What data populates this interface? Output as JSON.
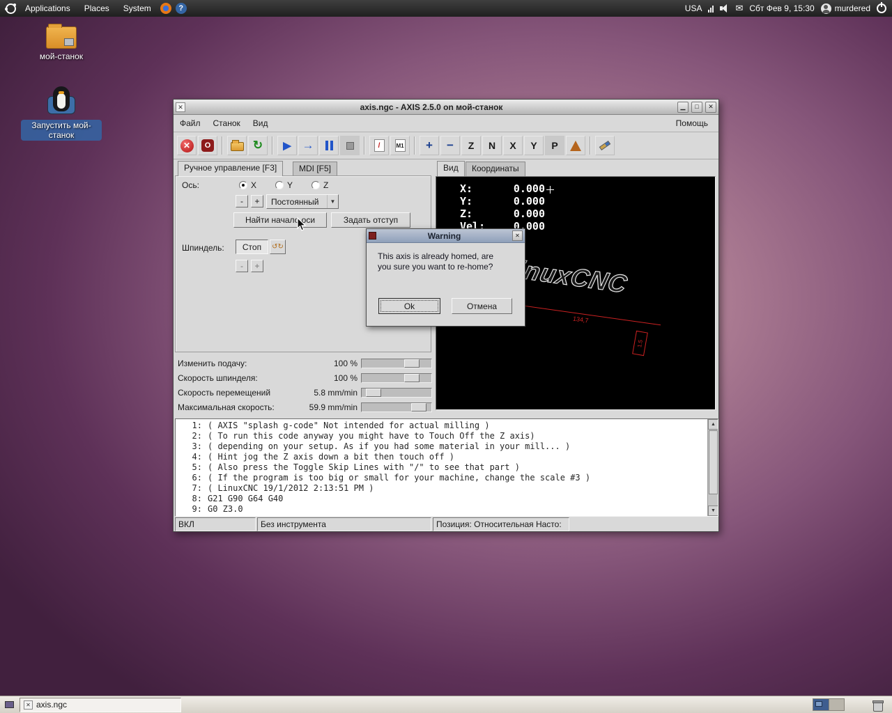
{
  "panel": {
    "menus": [
      "Applications",
      "Places",
      "System"
    ],
    "layout": "USA",
    "clock": "Сбт Фев  9, 15:30",
    "user": "murdered"
  },
  "desktop_icons": {
    "folder_label": "мой-станок",
    "launcher_label": "Запустить мой-станок"
  },
  "taskbar": {
    "task_label": "axis.ngc"
  },
  "window": {
    "title": "axis.ngc - AXIS 2.5.0 on мой-станок",
    "menus": [
      "Файл",
      "Станок",
      "Вид"
    ],
    "help_menu": "Помощь",
    "toolbar": {
      "estop": "✕",
      "power": "O",
      "reload": "↻",
      "run": "▶",
      "step": "→",
      "skip": "/",
      "m1": "M1",
      "zoom_in": "+",
      "zoom_out": "−",
      "views": [
        "Z",
        "N",
        "X",
        "Y",
        "P"
      ]
    },
    "left_tabs": [
      "Ручное управление [F3]",
      "MDI [F5]"
    ],
    "axis_row": {
      "label": "Ось:",
      "options": [
        "X",
        "Y",
        "Z"
      ],
      "selected": "X"
    },
    "jog": {
      "minus": "-",
      "plus": "+",
      "mode": "Постоянный"
    },
    "home_button": "Найти начало оси",
    "offset_button": "Задать отступ",
    "spindle": {
      "label": "Шпиндель:",
      "stop": "Стоп",
      "turn": "↺↻",
      "minus": "-",
      "plus": "+"
    },
    "overrides": [
      {
        "label": "Изменить подачу:",
        "value": "100 %"
      },
      {
        "label": "Скорость шпинделя:",
        "value": "100 %"
      },
      {
        "label": "Скорость перемещений",
        "value": "5.8 mm/min"
      },
      {
        "label": "Максимальная скорость:",
        "value": "59.9 mm/min"
      }
    ],
    "preview_tabs": [
      "Вид",
      "Координаты"
    ],
    "dro": [
      {
        "label": "X:",
        "value": "0.000"
      },
      {
        "label": "Y:",
        "value": "0.000"
      },
      {
        "label": "Z:",
        "value": "0.000"
      },
      {
        "label": "Vel:",
        "value": "0.000"
      }
    ],
    "logo_text": "LinuxCNC",
    "dim_label": "134,7",
    "dim_label2": "1.5",
    "gcode": [
      {
        "n": "1:",
        "t": "( AXIS \"splash g-code\" Not intended for actual milling )"
      },
      {
        "n": "2:",
        "t": "( To run this code anyway you might have to Touch Off the Z axis)"
      },
      {
        "n": "3:",
        "t": "( depending on your setup. As if you had some material in your mill... )"
      },
      {
        "n": "4:",
        "t": "( Hint jog the Z axis down a bit then touch off )"
      },
      {
        "n": "5:",
        "t": "( Also press the Toggle Skip Lines with \"/\" to see that part )"
      },
      {
        "n": "6:",
        "t": "( If the program is too big or small for your machine, change the scale #3 )"
      },
      {
        "n": "7:",
        "t": "( LinuxCNC 19/1/2012 2:13:51 PM )"
      },
      {
        "n": "8:",
        "t": "G21 G90 G64 G40"
      },
      {
        "n": "9:",
        "t": "G0 Z3.0"
      }
    ],
    "status": [
      "ВКЛ",
      "Без инструмента",
      "Позиция: Относительная Насто:"
    ]
  },
  "dialog": {
    "title": "Warning",
    "line1": "This axis is already homed, are",
    "line2": "you sure you want to re-home?",
    "ok": "Ok",
    "cancel": "Отмена"
  }
}
